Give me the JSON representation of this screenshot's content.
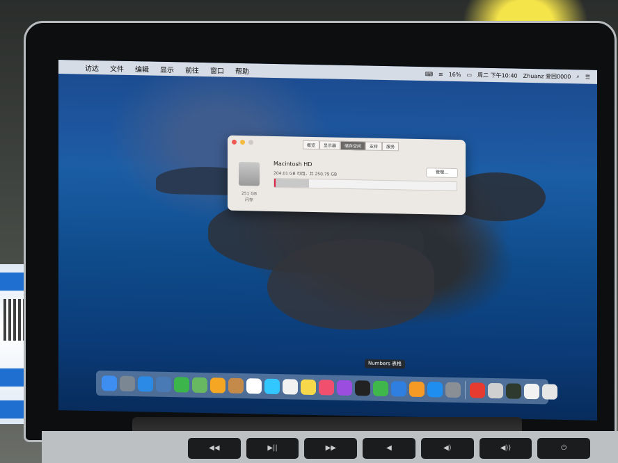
{
  "menubar": {
    "items": [
      "访达",
      "文件",
      "编辑",
      "显示",
      "前往",
      "窗口",
      "帮助"
    ],
    "battery": "16%",
    "clock": "周二 下午10:40",
    "user": "Zhuanz 爱回0000"
  },
  "dialog": {
    "tabs": [
      "概览",
      "显示器",
      "储存空间",
      "支持",
      "服务"
    ],
    "active_tab": 2,
    "disk_name": "Macintosh HD",
    "disk_info": "204.01 GB 可用，共 250.79 GB",
    "manage_label": "管理...",
    "capacity": "251 GB",
    "capacity_type": "闪存",
    "used_fraction": 0.19
  },
  "dock": {
    "tooltip": "Numbers 表格",
    "icons": [
      {
        "name": "finder-icon",
        "color": "#3d8ef0"
      },
      {
        "name": "launchpad-icon",
        "color": "#7c8794"
      },
      {
        "name": "safari-icon",
        "color": "#2b8ae5"
      },
      {
        "name": "photo-preview-icon",
        "color": "#4a7ab5"
      },
      {
        "name": "facetime-icon",
        "color": "#3cb64a"
      },
      {
        "name": "maps-icon",
        "color": "#67b860"
      },
      {
        "name": "photos-icon",
        "color": "#f5a623"
      },
      {
        "name": "contacts-icon",
        "color": "#c48a4a"
      },
      {
        "name": "calendar-icon",
        "color": "#ffffff"
      },
      {
        "name": "messages-icon",
        "color": "#32c7ff"
      },
      {
        "name": "reminders-icon",
        "color": "#f2f2f2"
      },
      {
        "name": "notes-icon",
        "color": "#f7d84a"
      },
      {
        "name": "music-icon",
        "color": "#f0506e"
      },
      {
        "name": "podcasts-icon",
        "color": "#9b4de0"
      },
      {
        "name": "tv-icon",
        "color": "#222222"
      },
      {
        "name": "numbers-icon",
        "color": "#3fb74a"
      },
      {
        "name": "keynote-icon",
        "color": "#2f7fe0"
      },
      {
        "name": "pages-icon",
        "color": "#f59a24"
      },
      {
        "name": "app-store-icon",
        "color": "#1e8ef1"
      },
      {
        "name": "system-preferences-icon",
        "color": "#8a8f96"
      },
      {
        "name": "wps-icon",
        "color": "#e53b31"
      },
      {
        "name": "activity-icon",
        "color": "#d0d0d0"
      },
      {
        "name": "terminal-icon",
        "color": "#2d3a2d"
      },
      {
        "name": "documents-icon",
        "color": "#f2f2f2"
      },
      {
        "name": "trash-icon",
        "color": "#e6e6e6"
      }
    ]
  },
  "keyboard": {
    "keys": [
      "◀◀",
      "▶||",
      "▶▶",
      "◀",
      "◀)",
      "◀))",
      "⏻"
    ]
  }
}
